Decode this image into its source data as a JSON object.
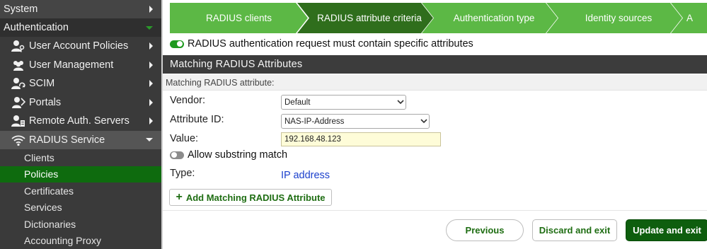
{
  "sidebar": {
    "top_items": [
      {
        "label": "System",
        "icon": "chevron-right-icon"
      },
      {
        "label": "Authentication",
        "icon": "chevron-down-icon"
      }
    ],
    "items": [
      {
        "label": "User Account Policies",
        "icon": "user-key-icon"
      },
      {
        "label": "User Management",
        "icon": "users-icon"
      },
      {
        "label": "SCIM",
        "icon": "user-sync-icon"
      },
      {
        "label": "Portals",
        "icon": "portal-icon"
      },
      {
        "label": "Remote Auth. Servers",
        "icon": "remote-server-icon"
      },
      {
        "label": "RADIUS Service",
        "icon": "wifi-icon"
      }
    ],
    "sub_items": [
      {
        "label": "Clients"
      },
      {
        "label": "Policies"
      },
      {
        "label": "Certificates"
      },
      {
        "label": "Services"
      },
      {
        "label": "Dictionaries"
      },
      {
        "label": "Accounting Proxy"
      }
    ]
  },
  "wizard": {
    "steps": [
      {
        "label": "RADIUS clients",
        "state": "done"
      },
      {
        "label": "RADIUS attribute criteria",
        "state": "current"
      },
      {
        "label": "Authentication type",
        "state": "todo"
      },
      {
        "label": "Identity sources",
        "state": "todo"
      },
      {
        "label": "A",
        "state": "todo"
      }
    ]
  },
  "toggle_require_attrs": {
    "label": "RADIUS authentication request must contain specific attributes",
    "on": true
  },
  "section": {
    "title": "Matching RADIUS Attributes",
    "subtitle": "Matching RADIUS attribute:"
  },
  "form": {
    "vendor_label": "Vendor:",
    "vendor_value": "Default",
    "attribute_label": "Attribute ID:",
    "attribute_value": "NAS-IP-Address",
    "value_label": "Value:",
    "value_value": "192.168.48.123",
    "substring_label": "Allow substring match",
    "substring_on": false,
    "type_label": "Type:",
    "type_value": "IP address"
  },
  "add_button": {
    "label": "Add Matching RADIUS Attribute"
  },
  "footer": {
    "previous": "Previous",
    "discard": "Discard and exit",
    "update": "Update and exit"
  },
  "colors": {
    "accent": "#0e6b0e",
    "step_done": "#5cb845",
    "step_current": "#2f6e1c",
    "link_blue": "#1a3fcc"
  }
}
